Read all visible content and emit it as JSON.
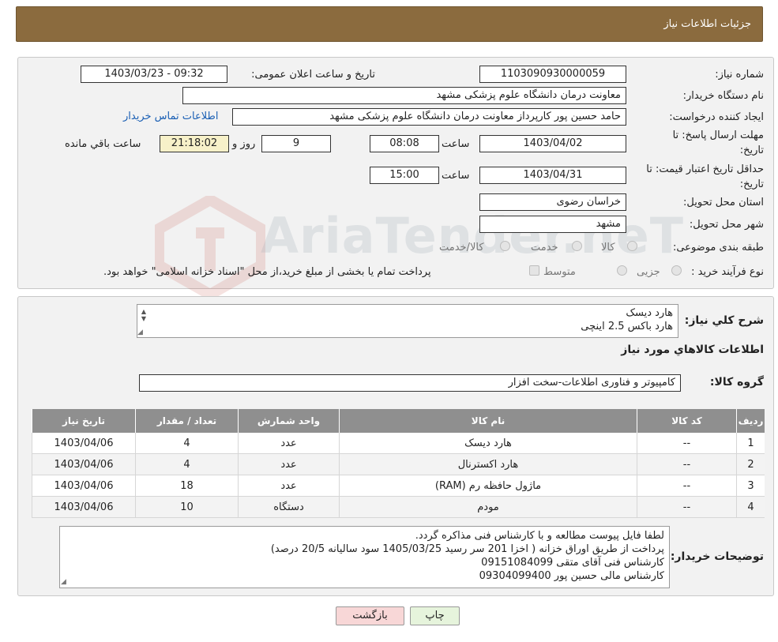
{
  "header": {
    "title": "جزئیات اطلاعات نیاز"
  },
  "form": {
    "need_number_label": "شماره نیاز:",
    "need_number": "1103090930000059",
    "announce_label": "تاریخ و ساعت اعلان عمومی:",
    "announce_value": "1403/03/23 - 09:32",
    "buyer_org_label": "نام دستگاه خریدار:",
    "buyer_org": "معاونت درمان دانشگاه علوم پزشکی مشهد",
    "creator_label": "ایجاد کننده درخواست:",
    "creator": "حامد حسین پور کارپرداز معاونت درمان دانشگاه علوم پزشکی مشهد",
    "contact_link": "اطلاعات تماس خریدار",
    "deadline_label_1": "مهلت ارسال پاسخ: تا",
    "deadline_label_2": "تاریخ:",
    "deadline_date": "1403/04/02",
    "time_label": "ساعت",
    "deadline_time": "08:08",
    "days": "9",
    "days_label": "روز و",
    "remaining": "21:18:02",
    "remaining_label": "ساعت باقي مانده",
    "validity_label_1": "حداقل تاریخ اعتبار قیمت: تا",
    "validity_label_2": "تاریخ:",
    "validity_date": "1403/04/31",
    "validity_time": "15:00",
    "province_label": "استان محل تحویل:",
    "province": "خراسان رضوی",
    "city_label": "شهر محل تحویل:",
    "city": "مشهد",
    "category_label": "طبقه بندی موضوعی:",
    "category_options": [
      "کالا",
      "خدمت",
      "کالا/خدمت"
    ],
    "process_label": "نوع فرآیند خرید :",
    "process_options": [
      "جزیی",
      "متوسط"
    ],
    "process_note": "پرداخت تمام یا بخشی از مبلغ خرید،از محل \"اسناد خزانه اسلامی\" خواهد بود."
  },
  "watermark": "AriaTender.neT",
  "summary": {
    "label": "شرح کلي نياز:",
    "lines": [
      "هارد دیسک",
      "هارد باکس 2.5 اینچی"
    ]
  },
  "goods_section": {
    "title": "اطلاعات کالاهاي مورد نياز",
    "group_label": "گروه کالا:",
    "group_value": "کامپیوتر و فناوری اطلاعات-سخت افزار"
  },
  "table": {
    "headers": [
      "ردیف",
      "کد کالا",
      "نام کالا",
      "واحد شمارش",
      "تعداد / مقدار",
      "تاریخ نیاز"
    ],
    "rows": [
      [
        "1",
        "--",
        "هارد دیسک",
        "عدد",
        "4",
        "1403/04/06"
      ],
      [
        "2",
        "--",
        "هارد اکسترنال",
        "عدد",
        "4",
        "1403/04/06"
      ],
      [
        "3",
        "--",
        "ماژول حافظه رم (RAM)",
        "عدد",
        "18",
        "1403/04/06"
      ],
      [
        "4",
        "--",
        "مودم",
        "دستگاه",
        "10",
        "1403/04/06"
      ]
    ]
  },
  "notes": {
    "label": "توضیحات خریدار:",
    "lines": [
      "لطفا فایل پیوست مطالعه و با کارشناس فنی مذاکره گردد.",
      "پرداخت از طریق اوراق خزانه ( اخزا 201 سر رسید 1405/03/25 سود سالیانه 20/5 درصد)",
      "کارشناس فنی آقای متقی 09151084099",
      "کارشناس مالی حسین پور 09304099400"
    ]
  },
  "buttons": {
    "print": "چاپ",
    "back": "بازگشت"
  },
  "colors": {
    "header": "#8b6b3e",
    "link": "#1a5fb4",
    "table_header": "#8f8f8f",
    "back_button": "#f8d7d7",
    "print_button": "#e6f4dc"
  }
}
